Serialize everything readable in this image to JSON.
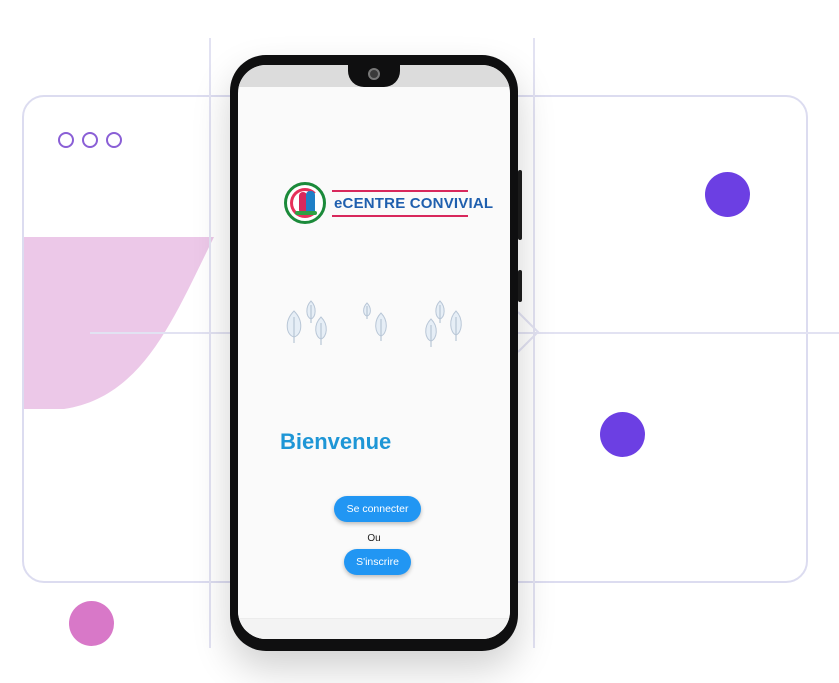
{
  "colors": {
    "accent": "#2196f3",
    "welcome_text": "#1e96d6",
    "brand_blue": "#1f5fae",
    "brand_pink": "#d8285c",
    "decor_purple": "#6c3fe3",
    "decor_pink": "#d878c8",
    "decor_lilac": "#ecc8e8"
  },
  "logo": {
    "text": "eCENTRE CONVIVIAL",
    "icon": "family-logo-icon"
  },
  "illustration": {
    "icon": "trees-illustration-icon"
  },
  "welcome": {
    "title": "Bienvenue"
  },
  "actions": {
    "login_label": "Se connecter",
    "separator": "Ou",
    "signup_label": "S'inscrire"
  },
  "decor": {
    "window_dots_icon": "window-dots-icon"
  }
}
